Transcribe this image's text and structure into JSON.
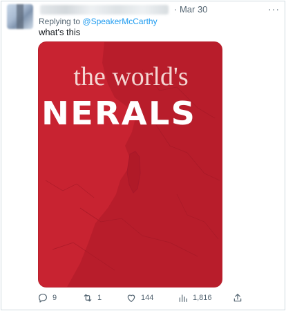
{
  "tweet": {
    "date": "· Mar 30",
    "more_icon": "ellipsis-icon",
    "replying_prefix": "Replying to",
    "replying_handle": "@SpeakerMcCarthy",
    "text": "what's this"
  },
  "media": {
    "title_line": "the world's",
    "sub_line": "NERALS",
    "background_color": "#c82331",
    "title_color": "#f4d6d3"
  },
  "actions": {
    "reply_count": "9",
    "retweet_count": "1",
    "like_count": "144",
    "views_count": "1,816",
    "icons": [
      "reply-icon",
      "retweet-icon",
      "like-icon",
      "views-icon",
      "share-icon"
    ]
  }
}
